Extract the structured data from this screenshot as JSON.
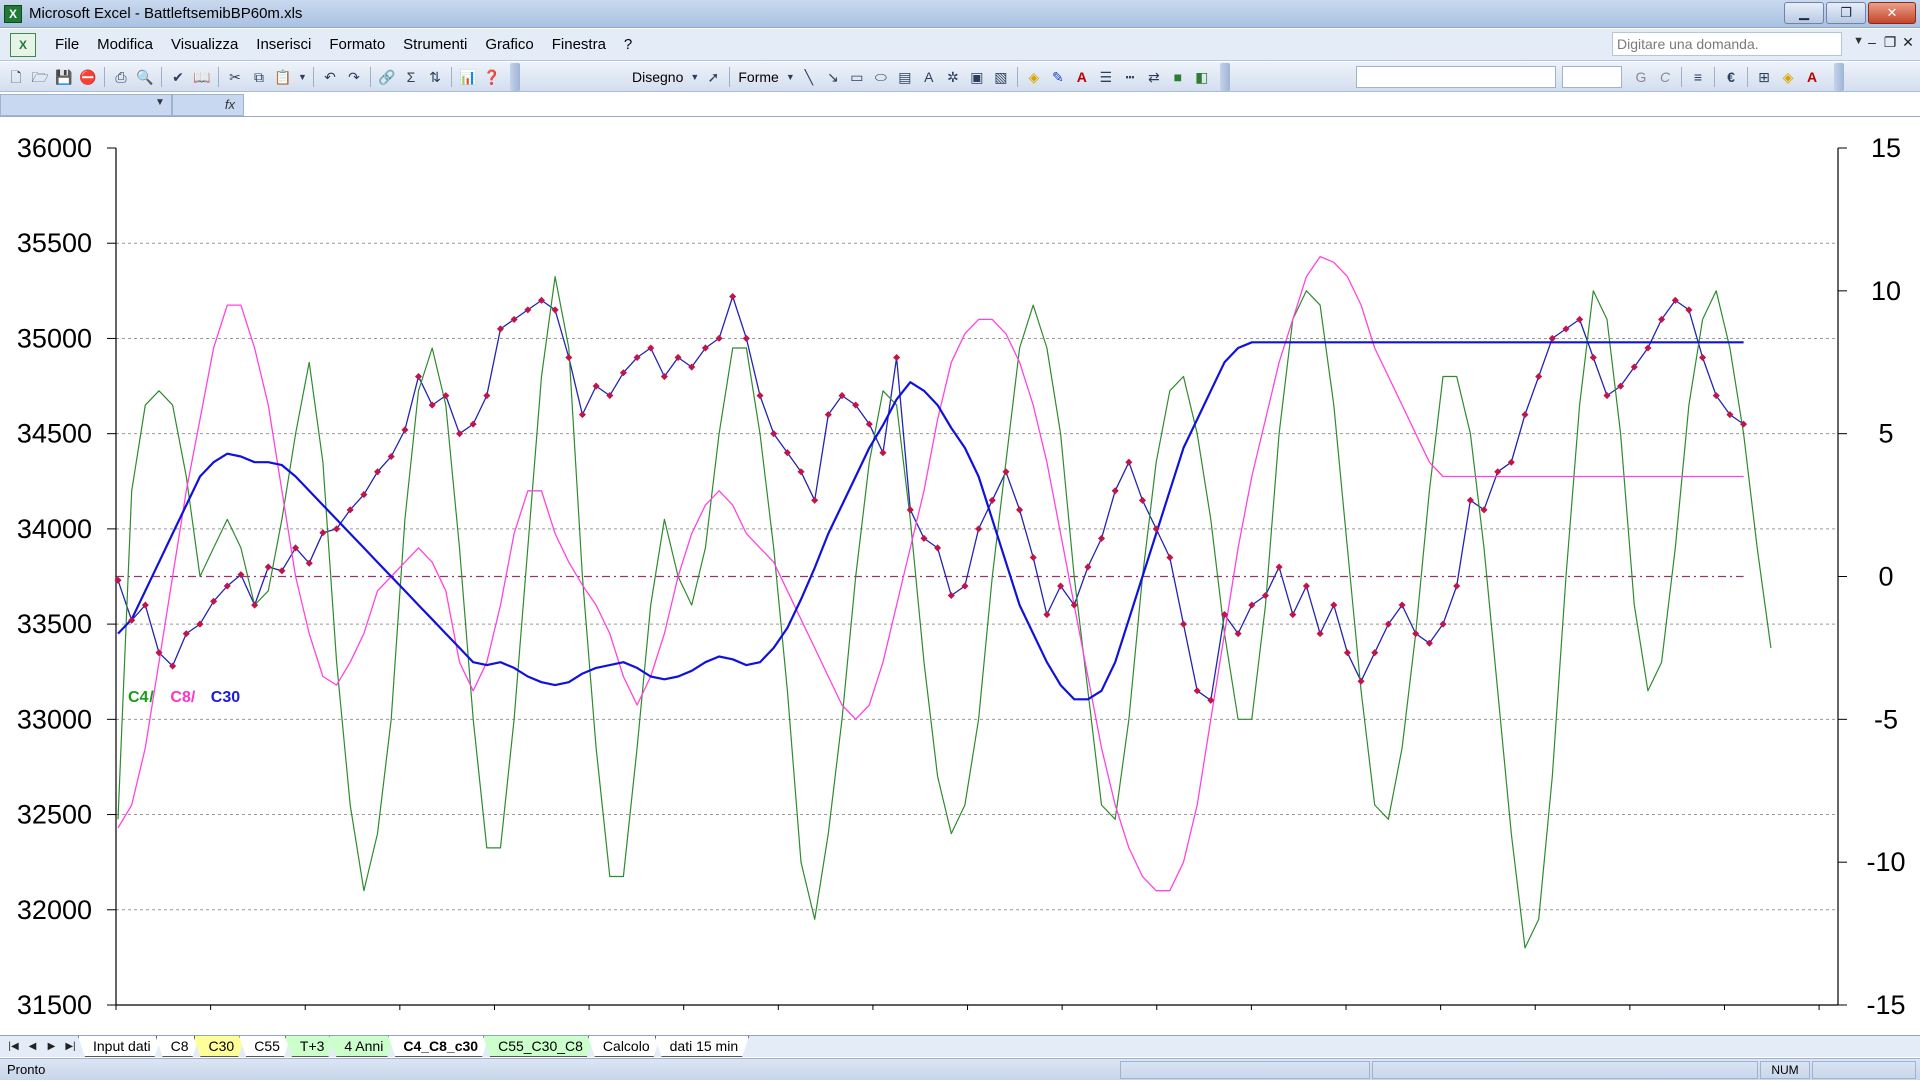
{
  "window": {
    "title": "Microsoft Excel - BattleftsemibBP60m.xls",
    "minimize_label": "▁",
    "restore_label": "❐",
    "close_label": "✕"
  },
  "menu": {
    "items": [
      "File",
      "Modifica",
      "Visualizza",
      "Inserisci",
      "Formato",
      "Strumenti",
      "Grafico",
      "Finestra",
      "?"
    ],
    "ask_placeholder": "Digitare una domanda."
  },
  "toolbar": {
    "drawing_label": "Disegno",
    "shapes_label": "Forme",
    "sum_label": "Σ",
    "bold_label": "G",
    "italic_label": "C",
    "euro_label": "€"
  },
  "formula_bar": {
    "fx_label": "fx"
  },
  "sheet_tabs": [
    {
      "label": "Input dati",
      "color": "#ffffff",
      "active": false
    },
    {
      "label": "C8",
      "color": "#ffffff",
      "active": false
    },
    {
      "label": "C30",
      "color": "#ffff99",
      "active": false
    },
    {
      "label": "C55",
      "color": "#ffffff",
      "active": false
    },
    {
      "label": "T+3",
      "color": "#ccffcc",
      "active": false
    },
    {
      "label": "4 Anni",
      "color": "#ccffcc",
      "active": false
    },
    {
      "label": "C4_C8_c30",
      "color": "#ffffff",
      "active": true
    },
    {
      "label": "C55_C30_C8",
      "color": "#ccffcc",
      "active": false
    },
    {
      "label": "Calcolo",
      "color": "#ffffff",
      "active": false
    },
    {
      "label": "dati 15 min",
      "color": "#ffffff",
      "active": false
    }
  ],
  "status": {
    "text": "Pronto",
    "num": "NUM"
  },
  "colors": {
    "price": "#2323b4",
    "price_marker": "#c0144a",
    "c4": "#2e8b2e",
    "c8": "#ff44dd",
    "c30": "#1111dd",
    "zero_line": "#a0306a",
    "grid": "#9a9a9a"
  },
  "chart_data": {
    "type": "line",
    "title": "",
    "legend_text": [
      {
        "text": "C4",
        "color": "#1a9a1a"
      },
      {
        "text": "/ ",
        "color": "#1a9a1a"
      },
      {
        "text": "C8/ ",
        "color": "#ff33cc"
      },
      {
        "text": "C30",
        "color": "#1a1add"
      }
    ],
    "y_left": {
      "min": 31500,
      "max": 36000,
      "ticks": [
        31500,
        32000,
        32500,
        33000,
        33500,
        34000,
        34500,
        35000,
        35500,
        36000
      ]
    },
    "y_right": {
      "min": -15,
      "max": 15,
      "ticks": [
        -15,
        -10,
        -5,
        0,
        5,
        10,
        15
      ]
    },
    "x_points": 120,
    "zero_line_value": 0,
    "series": [
      {
        "axis": "left",
        "markers": true,
        "values": [
          33730,
          33520,
          33600,
          33350,
          33280,
          33450,
          33500,
          33620,
          33700,
          33760,
          33600,
          33800,
          33780,
          33900,
          33820,
          33980,
          34000,
          34100,
          34180,
          34300,
          34380,
          34520,
          34800,
          34650,
          34700,
          34500,
          34550,
          34700,
          35050,
          35100,
          35150,
          35200,
          35150,
          34900,
          34600,
          34750,
          34700,
          34820,
          34900,
          34950,
          34800,
          34900,
          34850,
          34950,
          35000,
          35220,
          35000,
          34700,
          34500,
          34400,
          34300,
          34150,
          34600,
          34700,
          34650,
          34550,
          34400,
          34900,
          34100,
          33950,
          33900,
          33650,
          33700,
          34000,
          34150,
          34300,
          34100,
          33850,
          33550,
          33700,
          33600,
          33800,
          33950,
          34200,
          34350,
          34150,
          34000,
          33850,
          33500,
          33150,
          33100,
          33550,
          33450,
          33600,
          33650,
          33800,
          33550,
          33700,
          33450,
          33600,
          33350,
          33200,
          33350,
          33500,
          33600,
          33450,
          33400,
          33500,
          33700,
          34150,
          34100,
          34300,
          34350,
          34600,
          34800,
          35000,
          35050,
          35100,
          34900,
          34700,
          34750,
          34850,
          34950,
          35100,
          35200,
          35150,
          34900,
          34700,
          34600,
          34550
        ]
      },
      {
        "axis": "right",
        "name": "C4",
        "values": [
          -8.5,
          3,
          6,
          6.5,
          6,
          3.5,
          0,
          1,
          2,
          1,
          -1,
          -0.5,
          2,
          5,
          7.5,
          4,
          -3,
          -8,
          -11,
          -9,
          -5,
          2,
          6.5,
          8,
          6,
          1,
          -5,
          -9.5,
          -9.5,
          -5,
          1,
          7,
          10.5,
          8,
          0,
          -6,
          -10.5,
          -10.5,
          -6,
          -1,
          2,
          0,
          -1,
          1,
          5,
          8,
          8,
          5,
          1,
          -4,
          -10,
          -12,
          -9,
          -5,
          0,
          4,
          6.5,
          6,
          2,
          -3,
          -7,
          -9,
          -8,
          -5,
          0,
          4,
          8,
          9.5,
          8,
          5,
          0,
          -4,
          -8,
          -8.5,
          -5,
          0,
          4,
          6.5,
          7,
          5,
          2,
          -2,
          -5,
          -5,
          -1,
          5,
          9,
          10,
          9.5,
          6,
          1,
          -4,
          -8,
          -8.5,
          -6,
          -2,
          3,
          7,
          7,
          5,
          1,
          -4,
          -9,
          -13,
          -12,
          -7,
          0,
          6,
          10,
          9,
          5,
          -1,
          -4,
          -3,
          1,
          6,
          9,
          10,
          8,
          5,
          1,
          -2.5
        ]
      },
      {
        "axis": "right",
        "name": "C8",
        "values": [
          -8.8,
          -8,
          -6,
          -3,
          0,
          3,
          5.5,
          8,
          9.5,
          9.5,
          8,
          6,
          3,
          0,
          -2,
          -3.5,
          -3.8,
          -3,
          -2,
          -0.5,
          0,
          0.5,
          1,
          0.5,
          -0.5,
          -3,
          -4,
          -3,
          -1,
          1.5,
          3,
          3,
          1.5,
          0.5,
          -0.3,
          -1,
          -2,
          -3.5,
          -4.5,
          -3.5,
          -2,
          0,
          1.5,
          2.5,
          3,
          2.5,
          1.5,
          1,
          0.5,
          -0.5,
          -1.5,
          -2.5,
          -3.5,
          -4.5,
          -5,
          -4.5,
          -3,
          -1,
          1,
          3,
          5.5,
          7.5,
          8.5,
          9,
          9,
          8.5,
          7.5,
          6,
          4,
          1.5,
          -1,
          -3.5,
          -6,
          -8,
          -9.5,
          -10.5,
          -11,
          -11,
          -10,
          -8,
          -5,
          -2,
          1,
          3.5,
          5.5,
          7.5,
          9,
          10.5,
          11.2,
          11,
          10.5,
          9.5,
          8,
          7,
          6,
          5,
          4,
          3.5,
          3.5,
          3.5,
          3.5,
          3.5,
          3.5,
          3.5,
          3.5,
          3.5,
          3.5,
          3.5,
          3.5,
          3.5,
          3.5,
          3.5,
          3.5,
          3.5,
          3.5,
          3.5,
          3.5,
          3.5,
          3.5,
          3.5
        ]
      },
      {
        "axis": "right",
        "name": "C30",
        "values": [
          -2,
          -1.5,
          -0.5,
          0.5,
          1.5,
          2.5,
          3.5,
          4,
          4.3,
          4.2,
          4,
          4,
          3.9,
          3.5,
          3,
          2.5,
          2,
          1.5,
          1,
          0.5,
          0,
          -0.5,
          -1,
          -1.5,
          -2,
          -2.5,
          -3,
          -3.1,
          -3,
          -3.2,
          -3.5,
          -3.7,
          -3.8,
          -3.7,
          -3.4,
          -3.2,
          -3.1,
          -3,
          -3.2,
          -3.5,
          -3.6,
          -3.5,
          -3.3,
          -3,
          -2.8,
          -2.9,
          -3.1,
          -3,
          -2.5,
          -1.8,
          -0.8,
          0.3,
          1.5,
          2.5,
          3.5,
          4.5,
          5.3,
          6.2,
          6.8,
          6.5,
          6,
          5.2,
          4.5,
          3.5,
          2,
          0.5,
          -1,
          -2,
          -3,
          -3.8,
          -4.3,
          -4.3,
          -4,
          -3,
          -1.5,
          0,
          1.5,
          3,
          4.5,
          5.5,
          6.5,
          7.5,
          8,
          8.2,
          8.2,
          8.2,
          8.2,
          8.2,
          8.2,
          8.2,
          8.2,
          8.2,
          8.2,
          8.2,
          8.2,
          8.2,
          8.2,
          8.2,
          8.2,
          8.2,
          8.2,
          8.2,
          8.2,
          8.2,
          8.2,
          8.2,
          8.2,
          8.2,
          8.2,
          8.2,
          8.2,
          8.2,
          8.2,
          8.2,
          8.2,
          8.2,
          8.2,
          8.2,
          8.2,
          8.2
        ]
      }
    ]
  }
}
